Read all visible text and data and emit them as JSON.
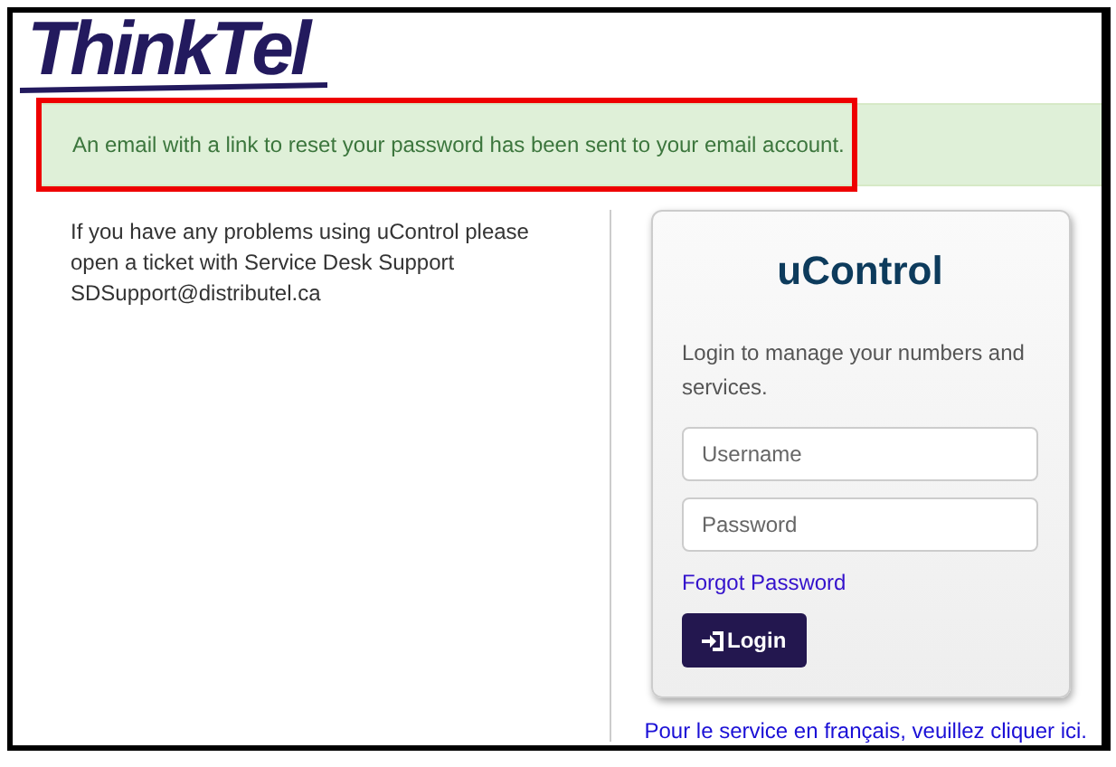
{
  "logo": {
    "text": "ThinkTel"
  },
  "alert": {
    "message": "An email with a link to reset your password has been sent to your email account.",
    "highlighted": true
  },
  "help_text": {
    "lines": [
      "If you have any problems using uControl please",
      "open a ticket with Service Desk Support",
      "SDSupport@distributel.ca"
    ]
  },
  "login": {
    "title": "uControl",
    "description": "Login to manage your numbers and services.",
    "username": {
      "placeholder": "Username"
    },
    "password": {
      "placeholder": "Password"
    },
    "forgot_link": "Forgot Password",
    "button": "Login"
  },
  "french_link": "Pour le service en français, veuillez cliquer ici."
}
